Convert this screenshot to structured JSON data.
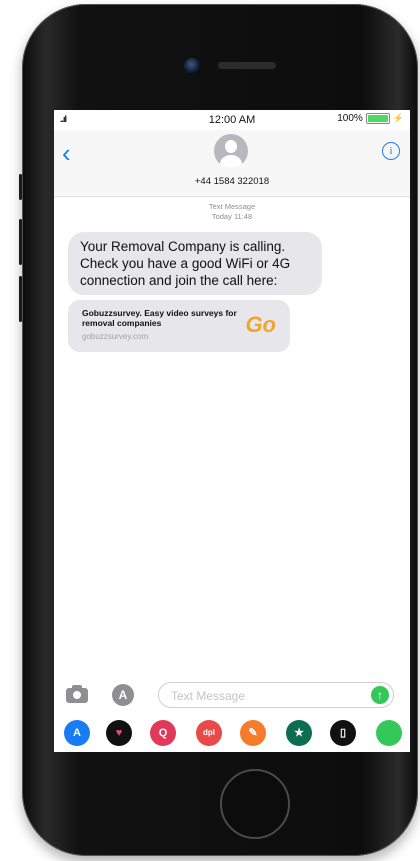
{
  "status": {
    "signal": "..ıl",
    "time": "12:00 AM",
    "battery": "100%",
    "battery_color": "#4cd964"
  },
  "header": {
    "back_icon": "chevron-left-icon",
    "contact_number": "+44 1584 322018",
    "info_icon": "info-icon"
  },
  "thread": {
    "service": "Text Message",
    "timestamp": "Today 11:48",
    "message": "Your Removal Company is calling. Check you have a good WiFi or 4G connection and join the call here:",
    "link_preview": {
      "title": "Gobuzzsurvey. Easy video surveys for removal companies",
      "url": "gobuzzsurvey.com",
      "logo_text": "Go",
      "logo_color": "#f2a52b"
    }
  },
  "compose": {
    "placeholder": "Text Message",
    "send_symbol": "↑",
    "app_store_symbol": "A"
  },
  "app_drawer": [
    {
      "name": "app-store",
      "symbol": "A",
      "color": "#1a7cf5"
    },
    {
      "name": "heart-sticker",
      "symbol": "♥",
      "color": "#d81b60"
    },
    {
      "name": "search-images",
      "symbol": "Q",
      "color": "#e03a5a"
    },
    {
      "name": "music",
      "symbol": "dpl",
      "color": "#e84a4a"
    },
    {
      "name": "paint",
      "symbol": "✎",
      "color": "#f57c2a"
    },
    {
      "name": "starbucks",
      "symbol": "★",
      "color": "#0b6e4f"
    },
    {
      "name": "notes",
      "symbol": "▯",
      "color": "#111111"
    },
    {
      "name": "more-apps",
      "symbol": "",
      "color": "#34c759"
    }
  ]
}
